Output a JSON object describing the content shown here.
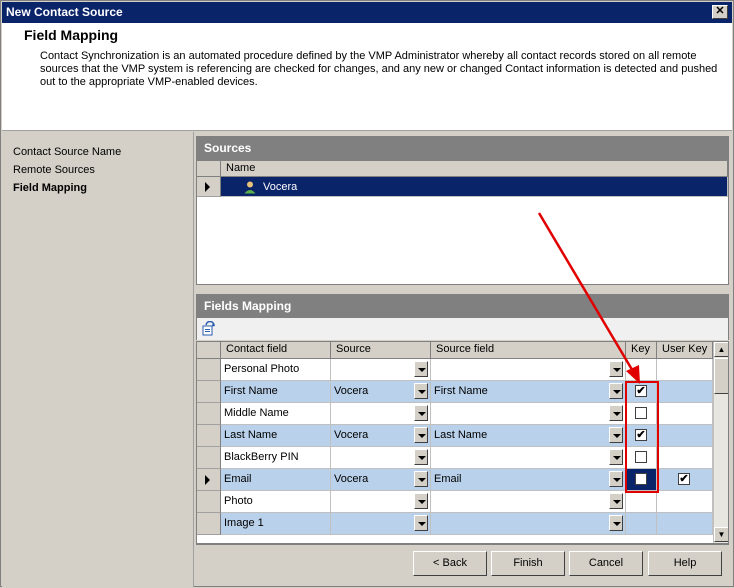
{
  "window": {
    "title": "New Contact Source",
    "close_label": "✕"
  },
  "header": {
    "title": "Field Mapping",
    "description": "Contact Synchronization is an automated procedure defined by the VMP Administrator whereby all contact records stored on all remote sources that the VMP system is referencing are checked for changes, and any new or changed Contact information is detected and pushed out to the appropriate VMP-enabled devices."
  },
  "nav": {
    "items": [
      {
        "label": "Contact Source Name"
      },
      {
        "label": "Remote Sources"
      },
      {
        "label": "Field Mapping"
      }
    ]
  },
  "sources": {
    "title": "Sources",
    "column_name": "Name",
    "rows": [
      {
        "name": "Vocera",
        "icon": "user-icon"
      }
    ]
  },
  "fields_mapping": {
    "title": "Fields Mapping",
    "columns": [
      "Contact field",
      "Source",
      "Source field",
      "Key",
      "User Key"
    ],
    "rows": [
      {
        "contact_field": "Personal Photo",
        "source": "",
        "source_field": "",
        "key": false,
        "user_key": false,
        "has_key": false
      },
      {
        "contact_field": "First Name",
        "source": "Vocera",
        "source_field": "First Name",
        "key": true,
        "user_key": false,
        "has_key": true
      },
      {
        "contact_field": "Middle Name",
        "source": "",
        "source_field": "",
        "key": false,
        "user_key": false,
        "has_key": true
      },
      {
        "contact_field": "Last Name",
        "source": "Vocera",
        "source_field": "Last Name",
        "key": true,
        "user_key": false,
        "has_key": true
      },
      {
        "contact_field": "BlackBerry PIN",
        "source": "",
        "source_field": "",
        "key": false,
        "user_key": false,
        "has_key": true
      },
      {
        "contact_field": "Email",
        "source": "Vocera",
        "source_field": "Email",
        "key": true,
        "user_key": true,
        "has_key": true
      },
      {
        "contact_field": "Photo",
        "source": "",
        "source_field": "",
        "key": false,
        "user_key": false,
        "has_key": false
      },
      {
        "contact_field": "Image 1",
        "source": "",
        "source_field": "",
        "key": false,
        "user_key": false,
        "has_key": false
      }
    ]
  },
  "buttons": {
    "back": "< Back",
    "finish": "Finish",
    "cancel": "Cancel",
    "help": "Help"
  },
  "colors": {
    "title_bar": "#0a246a",
    "alt_row": "#b9d1ea",
    "highlight": "#e00000"
  }
}
